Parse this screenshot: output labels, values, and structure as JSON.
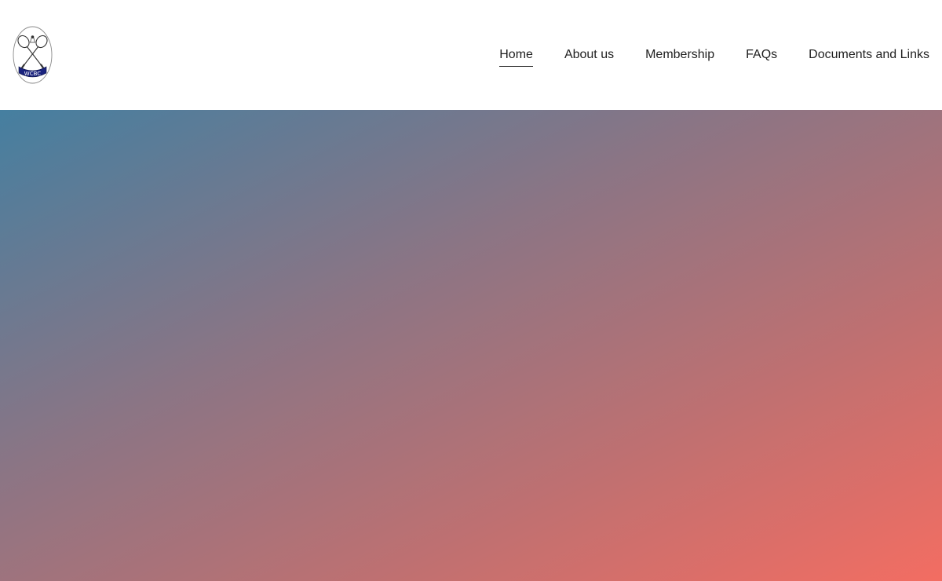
{
  "header": {
    "logo": {
      "text": "WCBC",
      "icon": "crossed-rackets-icon"
    },
    "nav": [
      {
        "label": "Home",
        "active": true
      },
      {
        "label": "About us",
        "active": false
      },
      {
        "label": "Membership",
        "active": false
      },
      {
        "label": "FAQs",
        "active": false
      },
      {
        "label": "Documents and Links",
        "active": false
      }
    ]
  },
  "hero": {
    "gradient_colors": [
      "#457fa0",
      "#8a7585",
      "#c27070",
      "#f36d62"
    ]
  },
  "colors": {
    "nav_text": "#1f1f1f",
    "logo_banner": "#1a237e",
    "background": "#ffffff"
  }
}
